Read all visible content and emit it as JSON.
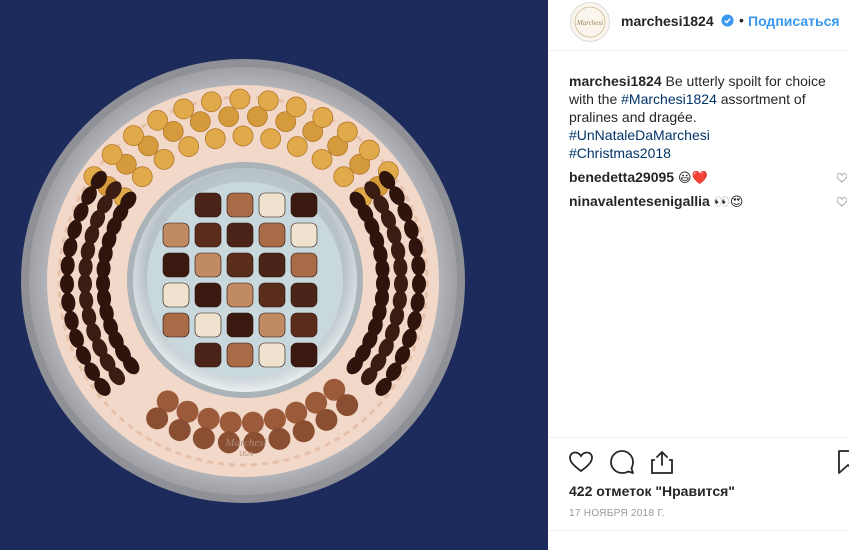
{
  "post": {
    "image_alt": "Platter of pralines and dragée",
    "tray_stamp": "Marchesi",
    "tray_stamp_year": "1824"
  },
  "header": {
    "username": "marchesi1824",
    "separator": "•",
    "follow_label": "Подписаться",
    "avatar_text": "Marchesi"
  },
  "caption": {
    "username": "marchesi1824",
    "text": "Be utterly spoilt for choice with the",
    "hashtag_inline": "#Marchesi1824",
    "text_after": "assortment of pralines and dragée.",
    "hashtags": [
      "#UnNataleDaMarchesi",
      "#Christmas2018"
    ]
  },
  "comments": [
    {
      "username": "benedetta29095",
      "emoji": "😃❤️"
    },
    {
      "username": "ninavalentesenigallia",
      "emoji": "👀😍"
    }
  ],
  "engagement": {
    "likes": "422 отметок \"Нравится\"",
    "date": "17 НОЯБРЯ 2018 Г."
  },
  "icons": [
    "heart-icon",
    "comment-icon",
    "share-icon",
    "bookmark-icon",
    "verified-icon"
  ],
  "colors": {
    "link": "#3897f0",
    "hashtag": "#003569",
    "background_photo": "#1c2a5c"
  }
}
